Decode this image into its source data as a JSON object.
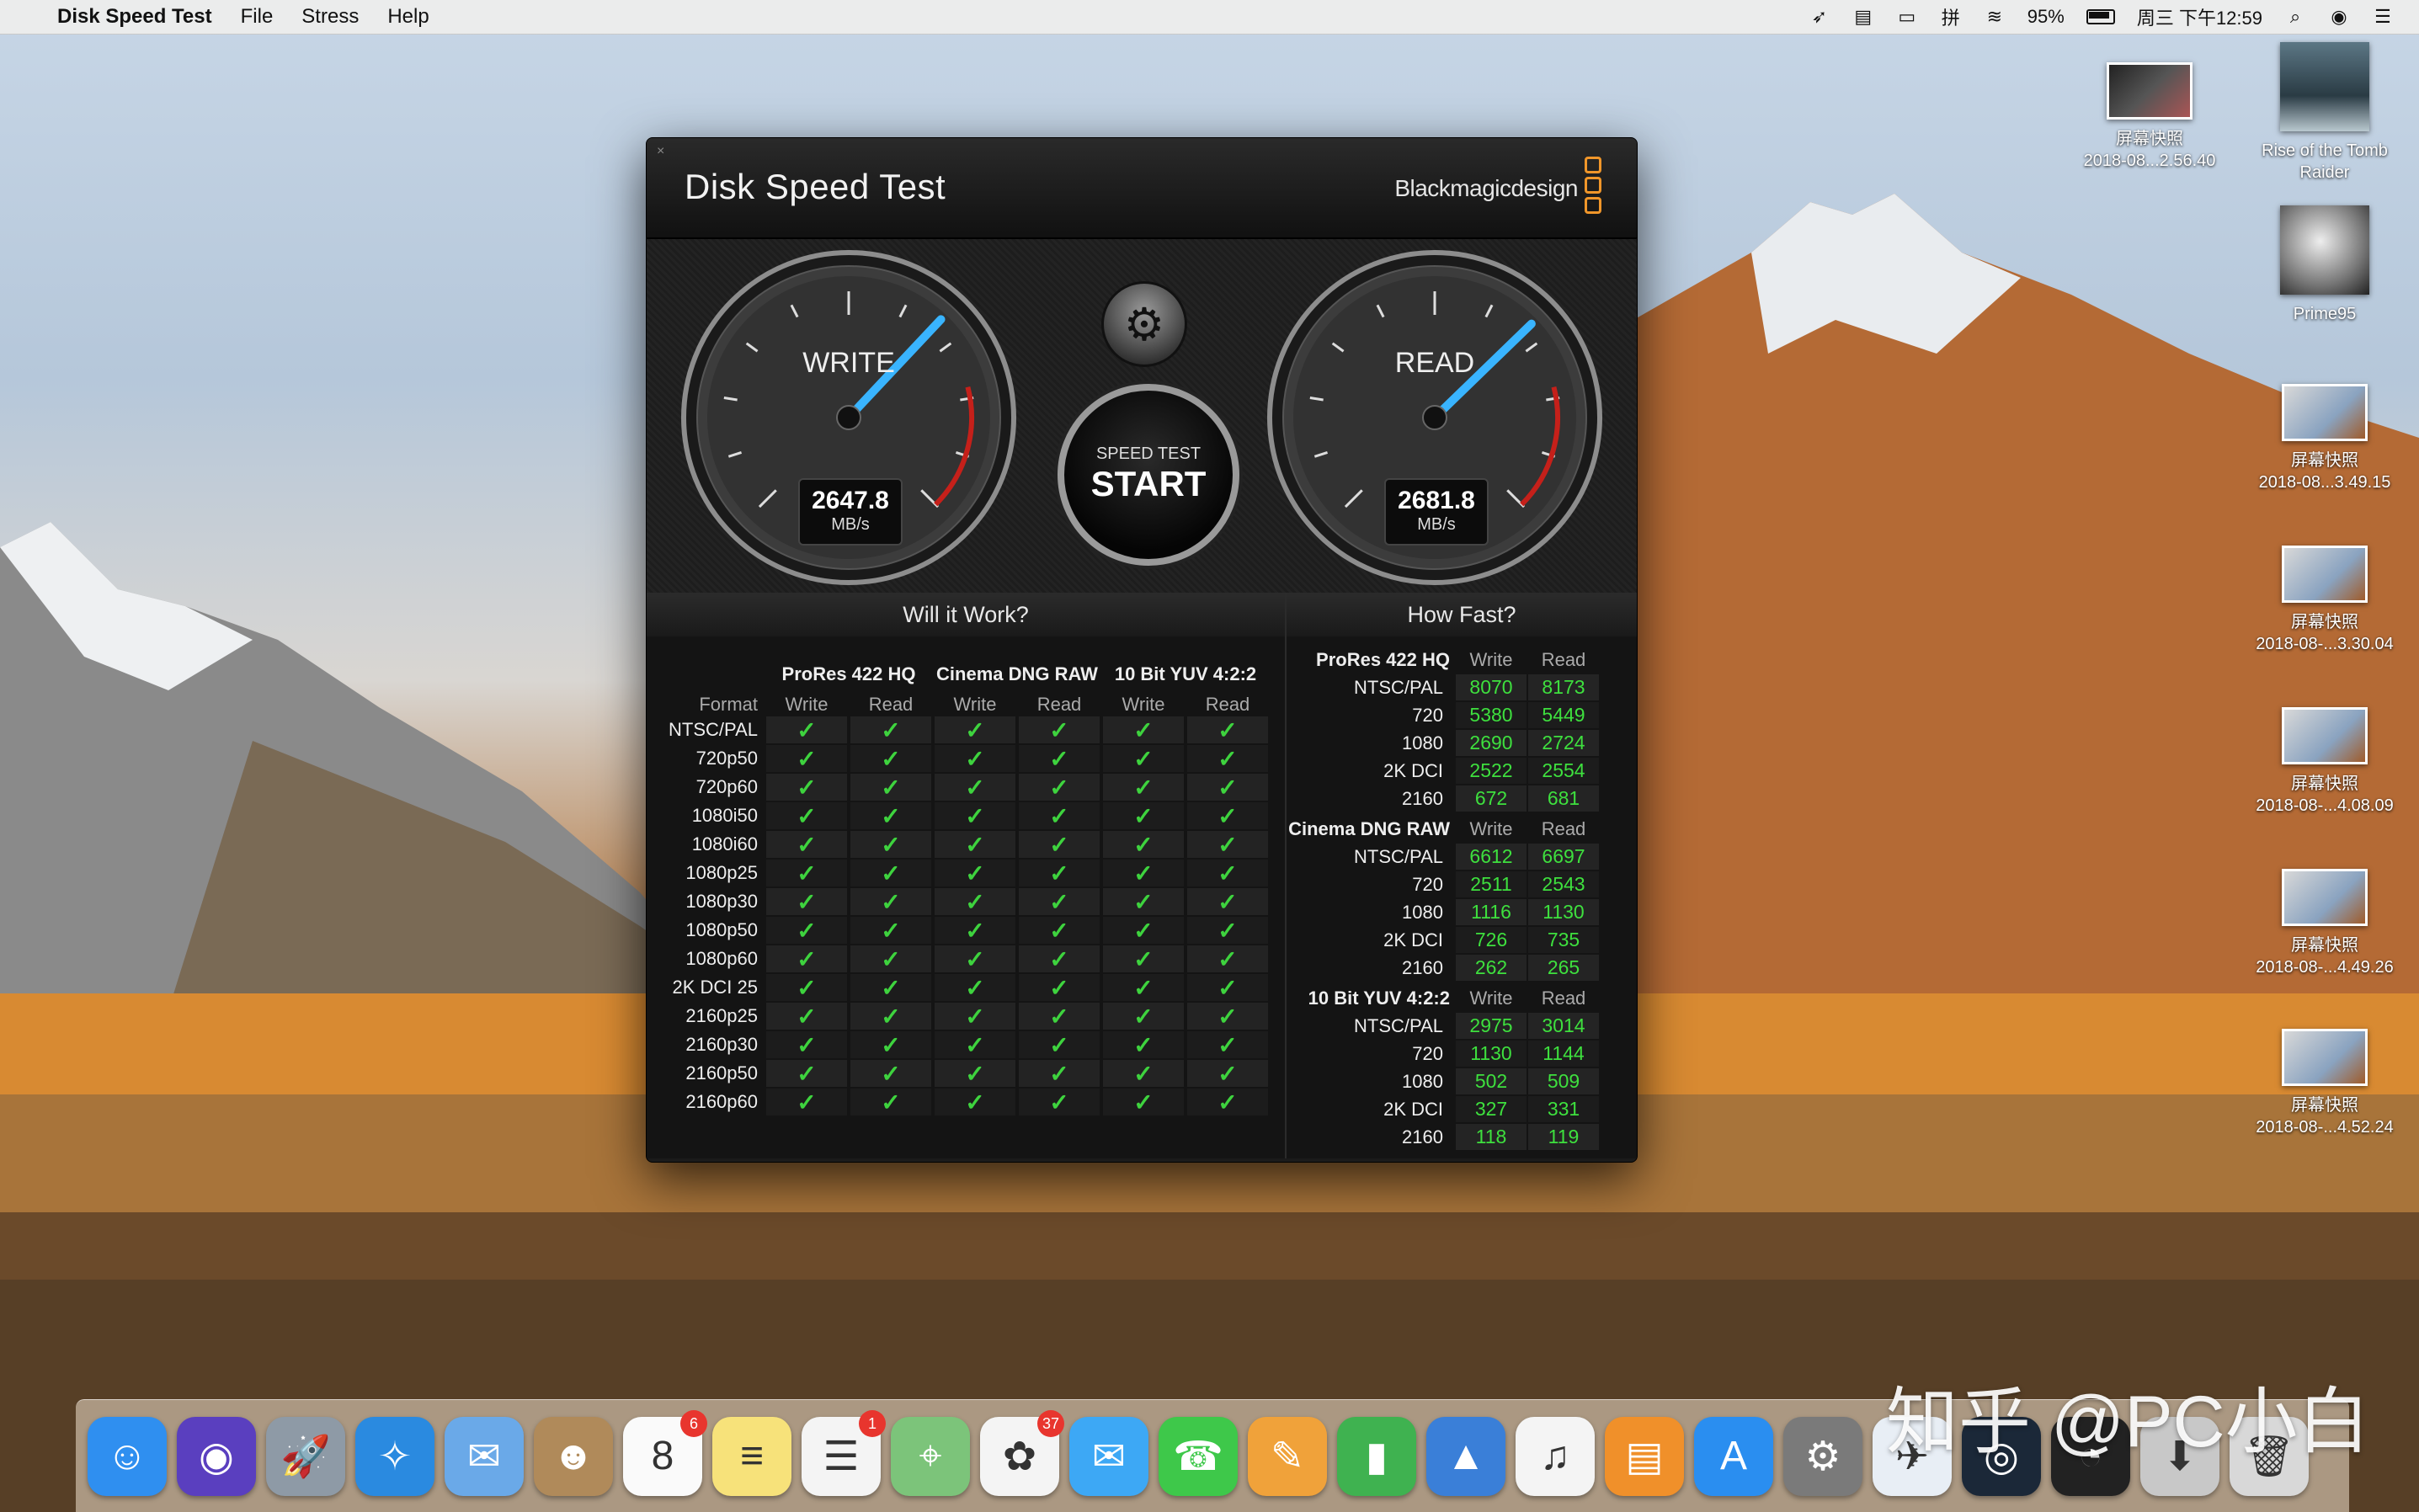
{
  "menubar": {
    "app_name": "Disk Speed Test",
    "menus": [
      "File",
      "Stress",
      "Help"
    ],
    "battery": "95%",
    "clock": "周三 下午12:59"
  },
  "desktop_icons": [
    {
      "label": "屏幕快照",
      "sub": "2018-08...2.56.40"
    },
    {
      "label": "Rise of the Tomb",
      "sub": "Raider"
    },
    {
      "label": "Prime95",
      "sub": ""
    },
    {
      "label": "屏幕快照",
      "sub": "2018-08...3.49.15"
    },
    {
      "label": "屏幕快照",
      "sub": "2018-08-...3.30.04"
    },
    {
      "label": "屏幕快照",
      "sub": "2018-08-...4.08.09"
    },
    {
      "label": "屏幕快照",
      "sub": "2018-08-...4.49.26"
    },
    {
      "label": "屏幕快照",
      "sub": "2018-08-...4.52.24"
    }
  ],
  "window": {
    "title": "Disk Speed Test",
    "brand": "Blackmagicdesign",
    "close_glyph": "×",
    "write": {
      "label": "WRITE",
      "value": "2647.8",
      "unit": "MB/s",
      "needle_fraction": 0.66
    },
    "read": {
      "label": "READ",
      "value": "2681.8",
      "unit": "MB/s",
      "needle_fraction": 0.67
    },
    "start": {
      "small": "SPEED TEST",
      "big": "START"
    },
    "settings_icon": "gear-icon"
  },
  "will_it_work": {
    "title": "Will it Work?",
    "format_header": "Format",
    "groups": [
      "ProRes 422 HQ",
      "Cinema DNG RAW",
      "10 Bit YUV 4:2:2"
    ],
    "sub_headers": [
      "Write",
      "Read",
      "Write",
      "Read",
      "Write",
      "Read"
    ],
    "check_glyph": "✓",
    "rows": [
      "NTSC/PAL",
      "720p50",
      "720p60",
      "1080i50",
      "1080i60",
      "1080p25",
      "1080p30",
      "1080p50",
      "1080p60",
      "2K DCI 25",
      "2160p25",
      "2160p30",
      "2160p50",
      "2160p60"
    ]
  },
  "how_fast": {
    "title": "How Fast?",
    "write_header": "Write",
    "read_header": "Read",
    "groups": [
      {
        "name": "ProRes 422 HQ",
        "rows": [
          {
            "name": "NTSC/PAL",
            "write": "8070",
            "read": "8173"
          },
          {
            "name": "720",
            "write": "5380",
            "read": "5449"
          },
          {
            "name": "1080",
            "write": "2690",
            "read": "2724"
          },
          {
            "name": "2K DCI",
            "write": "2522",
            "read": "2554"
          },
          {
            "name": "2160",
            "write": "672",
            "read": "681"
          }
        ]
      },
      {
        "name": "Cinema DNG RAW",
        "rows": [
          {
            "name": "NTSC/PAL",
            "write": "6612",
            "read": "6697"
          },
          {
            "name": "720",
            "write": "2511",
            "read": "2543"
          },
          {
            "name": "1080",
            "write": "1116",
            "read": "1130"
          },
          {
            "name": "2K DCI",
            "write": "726",
            "read": "735"
          },
          {
            "name": "2160",
            "write": "262",
            "read": "265"
          }
        ]
      },
      {
        "name": "10 Bit YUV 4:2:2",
        "rows": [
          {
            "name": "NTSC/PAL",
            "write": "2975",
            "read": "3014"
          },
          {
            "name": "720",
            "write": "1130",
            "read": "1144"
          },
          {
            "name": "1080",
            "write": "502",
            "read": "509"
          },
          {
            "name": "2K DCI",
            "write": "327",
            "read": "331"
          },
          {
            "name": "2160",
            "write": "118",
            "read": "119"
          }
        ]
      }
    ]
  },
  "dock": {
    "items": [
      {
        "name": "finder",
        "glyph": "☺",
        "color": "#2f8ff0",
        "badge": ""
      },
      {
        "name": "siri",
        "glyph": "◉",
        "color": "#5a3fbf",
        "badge": ""
      },
      {
        "name": "launchpad",
        "glyph": "🚀",
        "color": "#8e9aa6",
        "badge": ""
      },
      {
        "name": "safari",
        "glyph": "✧",
        "color": "#2a8ae0",
        "badge": ""
      },
      {
        "name": "mail",
        "glyph": "✉",
        "color": "#6aa9e8",
        "badge": ""
      },
      {
        "name": "contacts",
        "glyph": "☻",
        "color": "#b08a5a",
        "badge": ""
      },
      {
        "name": "calendar",
        "glyph": "8",
        "color": "#fafafa",
        "badge": "6"
      },
      {
        "name": "notes",
        "glyph": "≡",
        "color": "#f7e27a",
        "badge": ""
      },
      {
        "name": "reminders",
        "glyph": "☰",
        "color": "#f4f4f4",
        "badge": "1"
      },
      {
        "name": "maps",
        "glyph": "⌖",
        "color": "#7cc47a",
        "badge": ""
      },
      {
        "name": "photos",
        "glyph": "✿",
        "color": "#f4f4f4",
        "badge": "37"
      },
      {
        "name": "messages",
        "glyph": "✉",
        "color": "#3da8f5",
        "badge": ""
      },
      {
        "name": "facetime",
        "glyph": "☎",
        "color": "#3ec84a",
        "badge": ""
      },
      {
        "name": "pages",
        "glyph": "✎",
        "color": "#f0a23a",
        "badge": ""
      },
      {
        "name": "numbers",
        "glyph": "▮",
        "color": "#3fb250",
        "badge": ""
      },
      {
        "name": "keynote",
        "glyph": "▲",
        "color": "#3a7fd8",
        "badge": ""
      },
      {
        "name": "music",
        "glyph": "♫",
        "color": "#f4f4f4",
        "badge": ""
      },
      {
        "name": "books",
        "glyph": "▤",
        "color": "#f0902a",
        "badge": ""
      },
      {
        "name": "app-store",
        "glyph": "A",
        "color": "#2a8ef0",
        "badge": ""
      },
      {
        "name": "system-preferences",
        "glyph": "⚙",
        "color": "#7a7a7a",
        "badge": ""
      },
      {
        "name": "xcode-tool",
        "glyph": "✈",
        "color": "#e8eef5",
        "badge": ""
      },
      {
        "name": "steam",
        "glyph": "◎",
        "color": "#1b2838",
        "badge": ""
      },
      {
        "name": "disk-speed-test",
        "glyph": "◔",
        "color": "#222222",
        "badge": ""
      },
      {
        "name": "downloads",
        "glyph": "⬇",
        "color": "#c8c8c8",
        "badge": ""
      },
      {
        "name": "trash",
        "glyph": "🗑",
        "color": "#d8d8d8",
        "badge": ""
      }
    ]
  },
  "watermark": "知乎 @PC小白"
}
